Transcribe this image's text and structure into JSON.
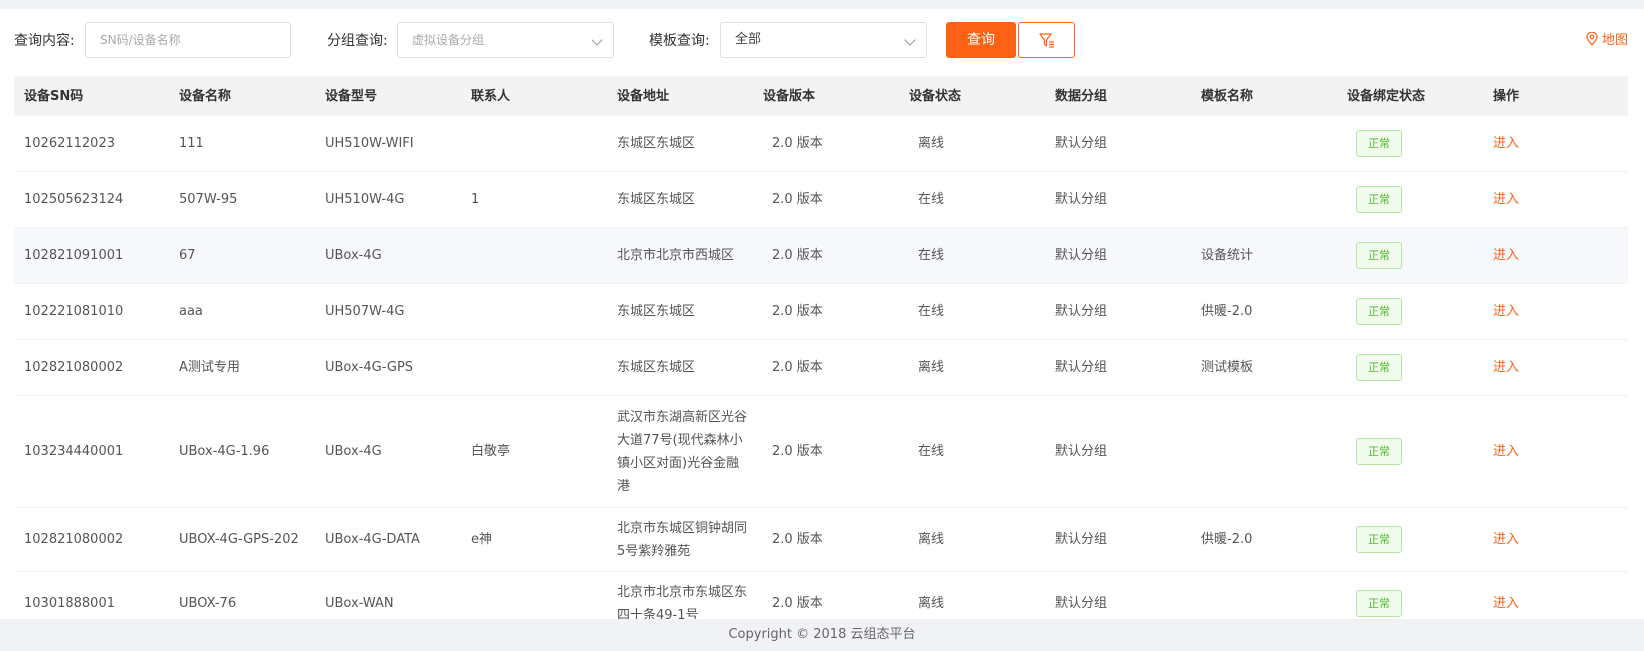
{
  "search": {
    "content_label": "查询内容:",
    "content_placeholder": "SN码/设备名称",
    "group_label": "分组查询:",
    "group_placeholder": "虚拟设备分组",
    "template_label": "模板查询:",
    "template_value": "全部",
    "query_button": "查询",
    "map_link": "地图"
  },
  "table": {
    "columns": [
      "设备SN码",
      "设备名称",
      "设备型号",
      "联系人",
      "设备地址",
      "设备版本",
      "设备状态",
      "数据分组",
      "模板名称",
      "设备绑定状态",
      "操作"
    ],
    "rows": [
      {
        "sn": "10262112023",
        "name": "111",
        "model": "UH510W-WIFI",
        "contact": "",
        "address": "东城区东城区",
        "version": "2.0 版本",
        "status": "离线",
        "group": "默认分组",
        "template": "",
        "bind": "正常",
        "action": "进入"
      },
      {
        "sn": "102505623124",
        "name": "507W-95",
        "model": "UH510W-4G",
        "contact": "1",
        "address": "东城区东城区",
        "version": "2.0 版本",
        "status": "在线",
        "group": "默认分组",
        "template": "",
        "bind": "正常",
        "action": "进入"
      },
      {
        "sn": "102821091001",
        "name": "67",
        "model": "UBox-4G",
        "contact": "",
        "address": "北京市北京市西城区",
        "version": "2.0 版本",
        "status": "在线",
        "group": "默认分组",
        "template": "设备统计",
        "bind": "正常",
        "action": "进入"
      },
      {
        "sn": "102221081010",
        "name": "aaa",
        "model": "UH507W-4G",
        "contact": "",
        "address": "东城区东城区",
        "version": "2.0 版本",
        "status": "在线",
        "group": "默认分组",
        "template": "供暖-2.0",
        "bind": "正常",
        "action": "进入"
      },
      {
        "sn": "102821080002",
        "name": "A测试专用",
        "model": "UBox-4G-GPS",
        "contact": "",
        "address": "东城区东城区",
        "version": "2.0 版本",
        "status": "离线",
        "group": "默认分组",
        "template": "测试模板",
        "bind": "正常",
        "action": "进入"
      },
      {
        "sn": "103234440001",
        "name": "UBox-4G-1.96",
        "model": "UBox-4G",
        "contact": "白敬亭",
        "address": "武汉市东湖高新区光谷大道77号(现代森林小镇小区对面)光谷金融港",
        "version": "2.0 版本",
        "status": "在线",
        "group": "默认分组",
        "template": "",
        "bind": "正常",
        "action": "进入"
      },
      {
        "sn": "102821080002",
        "name": "UBOX-4G-GPS-202",
        "model": "UBox-4G-DATA",
        "contact": "e神",
        "address": "北京市东城区铜钟胡同5号紫羚雅苑",
        "version": "2.0 版本",
        "status": "离线",
        "group": "默认分组",
        "template": "供暖-2.0",
        "bind": "正常",
        "action": "进入"
      },
      {
        "sn": "10301888001",
        "name": "UBOX-76",
        "model": "UBox-WAN",
        "contact": "",
        "address": "北京市北京市东城区东四十条49-1号",
        "version": "2.0 版本",
        "status": "离线",
        "group": "默认分组",
        "template": "",
        "bind": "正常",
        "action": "进入"
      }
    ]
  },
  "footer": {
    "copyright": "Copyright © 2018 云组态平台"
  },
  "colors": {
    "accent": "#fd6114",
    "status_ok": "#52b832"
  },
  "icons": {
    "filter": "filter-icon",
    "map": "map-pin-icon",
    "dropdown": "chevron-down-icon"
  }
}
